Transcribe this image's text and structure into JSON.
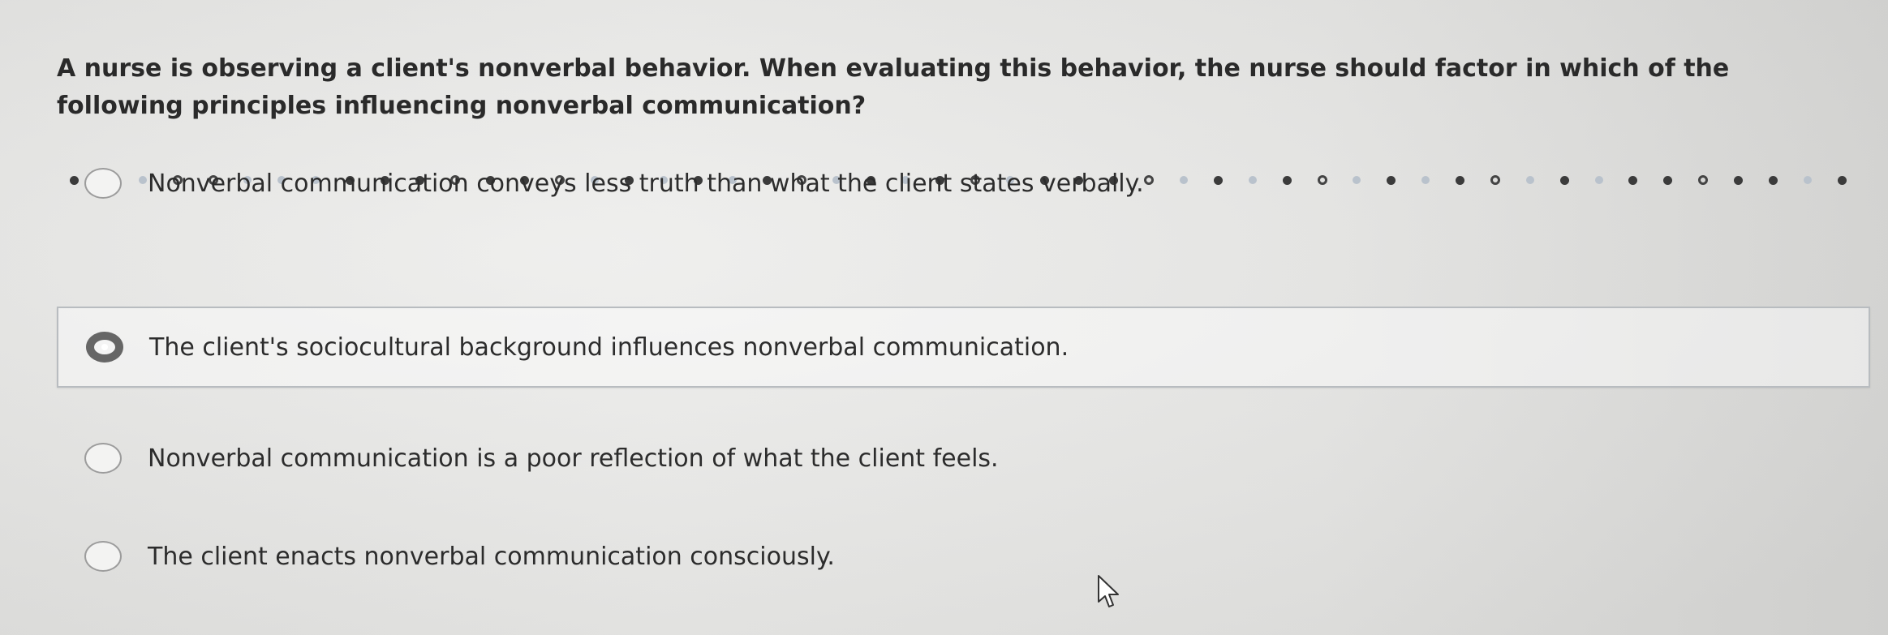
{
  "question": {
    "text": "A nurse is observing a client's nonverbal behavior. When evaluating this behavior, the nurse should factor in which of the following principles influencing nonverbal communication?"
  },
  "progress": {
    "dots": [
      "filled",
      "light",
      "light",
      "ring",
      "ring",
      "light",
      "light",
      "light",
      "filled",
      "filled",
      "filled",
      "ring",
      "filled",
      "filled",
      "ring",
      "light",
      "filled",
      "light",
      "filled",
      "light",
      "filled",
      "ring",
      "light",
      "filled",
      "light",
      "filled",
      "ring",
      "light",
      "filled",
      "filled",
      "filled",
      "ring",
      "light",
      "filled",
      "light",
      "filled",
      "ring",
      "light",
      "filled",
      "light",
      "filled",
      "ring",
      "light",
      "filled",
      "light",
      "filled",
      "filled",
      "ring",
      "filled",
      "filled",
      "light",
      "filled"
    ]
  },
  "options": [
    {
      "text": "Nonverbal communication conveys less truth than what the client states verbally.",
      "selected": false
    },
    {
      "text": "The client's sociocultural background influences nonverbal communication.",
      "selected": true
    },
    {
      "text": "Nonverbal communication is a poor reflection of what the client feels.",
      "selected": false
    },
    {
      "text": "The client enacts nonverbal communication consciously.",
      "selected": false
    }
  ],
  "colors": {
    "selected_border": "#b8bcc0",
    "radio_checked": "#666666"
  },
  "icons": {
    "cursor": "mouse-pointer-icon"
  }
}
